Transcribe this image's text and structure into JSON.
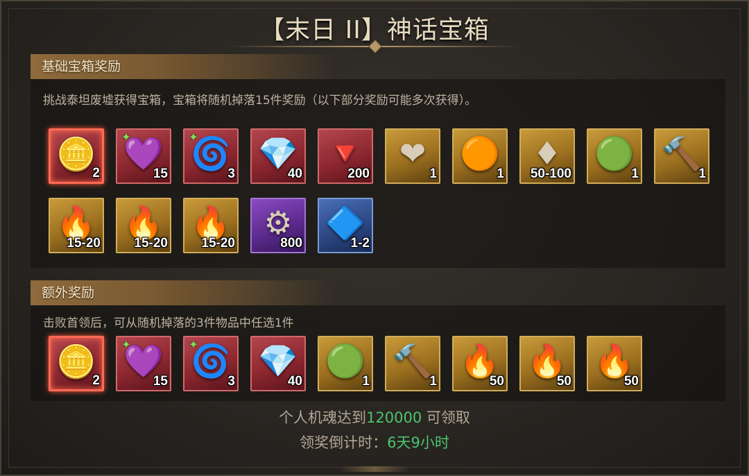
{
  "title": "【末日 II】神话宝箱",
  "basic": {
    "header": "基础宝箱奖励",
    "desc": "挑战泰坦废墟获得宝箱，宝箱将随机掉落15件奖励（以下部分奖励可能多次获得）。",
    "items": [
      {
        "icon": "gold-ore-icon",
        "glyph": "🪙",
        "frame": "red-highlight",
        "count": "2"
      },
      {
        "icon": "purple-crystal-claw-icon",
        "glyph": "💜",
        "frame": "red",
        "count": "15",
        "badge": true
      },
      {
        "icon": "golden-swirl-orb-icon",
        "glyph": "🌀",
        "frame": "red",
        "count": "3",
        "badge": true
      },
      {
        "icon": "red-gem-bundle-icon",
        "glyph": "💎",
        "frame": "red",
        "count": "40"
      },
      {
        "icon": "red-crystal-shards-icon",
        "glyph": "🔻",
        "frame": "red",
        "count": "200"
      },
      {
        "icon": "ruby-amulet-icon",
        "glyph": "❤",
        "frame": "gold",
        "count": "1"
      },
      {
        "icon": "amber-amulet-icon",
        "glyph": "🟠",
        "frame": "gold",
        "count": "1"
      },
      {
        "icon": "red-gems-icon",
        "glyph": "♦",
        "frame": "gold",
        "count": "50-100"
      },
      {
        "icon": "green-relic-icon",
        "glyph": "🟢",
        "frame": "gold",
        "count": "1"
      },
      {
        "icon": "war-hammer-icon",
        "glyph": "🔨",
        "frame": "gold",
        "count": "1"
      },
      {
        "icon": "green-flame-icon",
        "glyph": "🔥",
        "frame": "gold",
        "count": "15-20"
      },
      {
        "icon": "blue-flame-icon",
        "glyph": "🔥",
        "frame": "gold",
        "count": "15-20"
      },
      {
        "icon": "red-flame-icon",
        "glyph": "🔥",
        "frame": "gold",
        "count": "15-20"
      },
      {
        "icon": "silver-ore-icon",
        "glyph": "⚙",
        "frame": "purple",
        "count": "800"
      },
      {
        "icon": "sapphire-amulet-icon",
        "glyph": "🔷",
        "frame": "blue",
        "count": "1-2"
      }
    ]
  },
  "extra": {
    "header": "额外奖励",
    "desc": "击败首领后，可从随机掉落的3件物品中任选1件",
    "items": [
      {
        "icon": "gold-ore-icon",
        "glyph": "🪙",
        "frame": "red-highlight",
        "count": "2"
      },
      {
        "icon": "purple-crystal-claw-icon",
        "glyph": "💜",
        "frame": "red",
        "count": "15",
        "badge": true
      },
      {
        "icon": "golden-swirl-orb-icon",
        "glyph": "🌀",
        "frame": "red",
        "count": "3",
        "badge": true
      },
      {
        "icon": "red-gem-bundle-icon",
        "glyph": "💎",
        "frame": "red",
        "count": "40"
      },
      {
        "icon": "green-relic-icon",
        "glyph": "🟢",
        "frame": "gold",
        "count": "1"
      },
      {
        "icon": "war-hammer-icon",
        "glyph": "🔨",
        "frame": "gold",
        "count": "1"
      },
      {
        "icon": "green-flame-icon",
        "glyph": "🔥",
        "frame": "gold",
        "count": "50"
      },
      {
        "icon": "blue-flame-icon",
        "glyph": "🔥",
        "frame": "gold",
        "count": "50"
      },
      {
        "icon": "red-flame-icon",
        "glyph": "🔥",
        "frame": "gold",
        "count": "50"
      }
    ]
  },
  "footer": {
    "req_prefix": "个人机魂达到",
    "req_value": "120000",
    "req_suffix": " 可领取",
    "countdown_label": "领奖倒计时：",
    "countdown_value": "6天9小时"
  },
  "colors": {
    "highlight_green": "#4cc46e",
    "header_brown": "#8e6a3c"
  }
}
